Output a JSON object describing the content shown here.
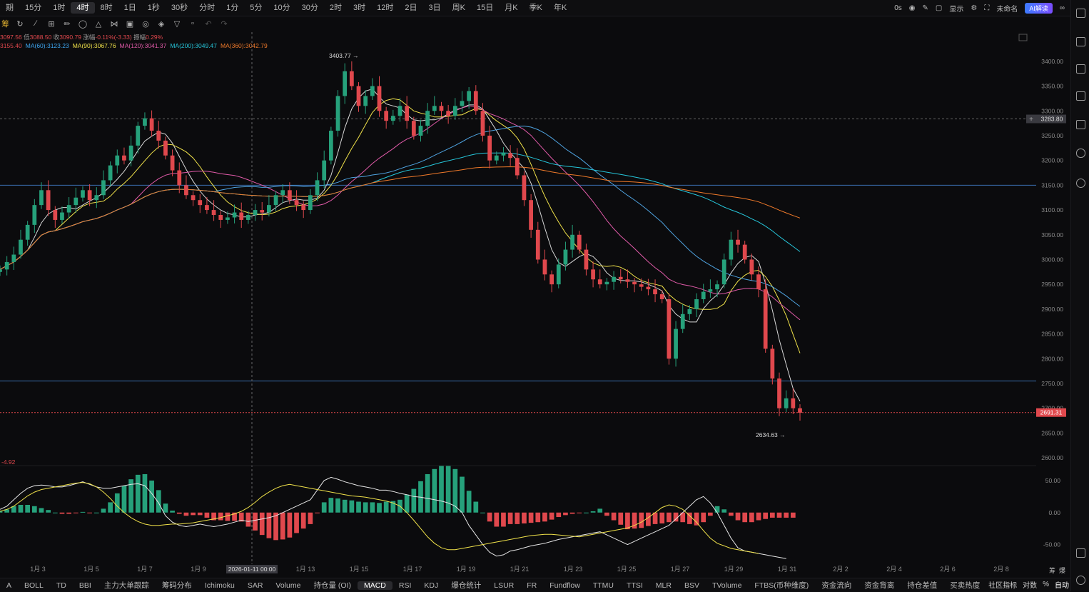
{
  "timeframes": [
    "期",
    "15分",
    "1时",
    "4时",
    "8时",
    "1日",
    "1秒",
    "30秒",
    "分时",
    "1分",
    "5分",
    "10分",
    "30分",
    "2时",
    "3时",
    "12时",
    "2日",
    "3日",
    "周K",
    "15日",
    "月K",
    "季K",
    "年K"
  ],
  "active_timeframe": "4时",
  "topright": {
    "countdown": "0s",
    "display": "显示",
    "layout_name": "未命名",
    "ai_label": "AI解读"
  },
  "toolbar_label": "筹",
  "ohlc": {
    "open": "3097.56",
    "low": "3088.50",
    "close": "3090.79",
    "change": "-0.11%(-3.33)",
    "amp": "0.29%",
    "prefix_open": "",
    "label_low": "低",
    "label_close": "收",
    "label_change": "涨幅",
    "label_amp": "振幅"
  },
  "ma_legend": [
    {
      "text": "3155.40",
      "color": "#e0484d"
    },
    {
      "text": "MA(60):3123.23",
      "color": "#3fa9f5"
    },
    {
      "text": "MA(90):3067.76",
      "color": "#f0e24a"
    },
    {
      "text": "MA(120):3041.37",
      "color": "#e05aa8"
    },
    {
      "text": "MA(200):3049.47",
      "color": "#26c6da"
    },
    {
      "text": "MA(360):3042.79",
      "color": "#f07a2a"
    }
  ],
  "macd_label": "-4.92",
  "indicators": [
    "A",
    "BOLL",
    "TD",
    "BBI",
    "主力大单跟踪",
    "筹码分布",
    "Ichimoku",
    "SAR",
    "Volume",
    "持仓量 (OI)",
    "MACD",
    "RSI",
    "KDJ",
    "爆仓统计",
    "LSUR",
    "FR",
    "Fundflow",
    "TTMU",
    "TTSI",
    "MLR",
    "BSV",
    "TVolume",
    "FTBS(币种维度)",
    "资金流向",
    "资金背离",
    "持仓差值",
    "买卖热度"
  ],
  "active_indicator": "MACD",
  "bottomright": {
    "community": "社区指标",
    "log": "对数",
    "pct": "%",
    "auto": "自动"
  },
  "chip_labels": [
    "筹",
    "爆"
  ],
  "colors": {
    "up": "#26a17b",
    "down": "#e0484d",
    "ma_fast": "#f0e24a",
    "ma_slow": "#d8d8d8",
    "ma_pink": "#e05aa8",
    "ma_blue": "#4fa3e0",
    "ma_cyan": "#26c6da",
    "ma_orange": "#f07a2a",
    "hline": "#3a6fb0"
  },
  "chart_data": {
    "type": "candlestick",
    "price_axis": {
      "ylim": [
        2590,
        3420
      ],
      "ticks": [
        "3400.00",
        "3350.00",
        "3300.00",
        "3250.00",
        "3200.00",
        "3150.00",
        "3100.00",
        "3050.00",
        "3000.00",
        "2950.00",
        "2900.00",
        "2850.00",
        "2800.00",
        "2750.00",
        "2700.00",
        "2650.00",
        "2600.00"
      ]
    },
    "macd_axis": {
      "ylim": [
        -75,
        70
      ],
      "ticks": [
        "50.00",
        "0.00",
        "-50.00"
      ]
    },
    "x_ticks": [
      "1月 3",
      "1月 5",
      "1月 7",
      "1月 9",
      "1月 13",
      "1月 15",
      "1月 17",
      "1月 19",
      "1月 21",
      "1月 23",
      "1月 25",
      "1月 27",
      "1月 29",
      "1月 31",
      "2月 2",
      "2月 4",
      "2月 6",
      "2月 8"
    ],
    "x_tick_days": [
      3,
      5,
      7,
      9,
      13,
      15,
      17,
      19,
      21,
      23,
      25,
      27,
      29,
      31,
      33,
      35,
      37,
      39
    ],
    "crosshair_label": "2026-01-11 00:00",
    "crosshair_day": 11,
    "crosshair_price": "3283.80",
    "last_price": "2691.31",
    "high_label": "3403.77",
    "low_label": "2634.63",
    "horizontal_lines": [
      3150,
      2755
    ],
    "closes": [
      2980,
      2995,
      3010,
      3040,
      3070,
      3110,
      3140,
      3100,
      3080,
      3095,
      3110,
      3125,
      3140,
      3120,
      3130,
      3160,
      3190,
      3210,
      3200,
      3230,
      3270,
      3285,
      3260,
      3240,
      3210,
      3180,
      3150,
      3130,
      3120,
      3110,
      3100,
      3090,
      3080,
      3085,
      3095,
      3080,
      3090,
      3100,
      3095,
      3110,
      3130,
      3140,
      3120,
      3110,
      3100,
      3130,
      3160,
      3200,
      3260,
      3330,
      3380,
      3350,
      3310,
      3330,
      3350,
      3300,
      3280,
      3290,
      3310,
      3280,
      3250,
      3270,
      3300,
      3310,
      3300,
      3290,
      3310,
      3320,
      3340,
      3300,
      3250,
      3200,
      3210,
      3215,
      3205,
      3170,
      3120,
      3060,
      3000,
      2970,
      2950,
      2990,
      3020,
      3050,
      3020,
      2980,
      2960,
      2950,
      2955,
      2965,
      2960,
      2955,
      2950,
      2945,
      2940,
      2930,
      2920,
      2800,
      2860,
      2890,
      2900,
      2920,
      2935,
      2940,
      2950,
      3000,
      3040,
      3030,
      3000,
      2970,
      2940,
      2820,
      2760,
      2700,
      2720,
      2700,
      2691
    ],
    "macd_dif": [
      5,
      10,
      20,
      30,
      38,
      42,
      43,
      42,
      40,
      40,
      42,
      45,
      48,
      44,
      40,
      38,
      38,
      40,
      42,
      44,
      45,
      42,
      30,
      15,
      -5,
      -15,
      -20,
      -22,
      -20,
      -18,
      -20,
      -22,
      -20,
      -18,
      -15,
      -12,
      -14,
      -12,
      -10,
      -8,
      -5,
      0,
      5,
      10,
      15,
      20,
      35,
      50,
      55,
      52,
      48,
      45,
      42,
      40,
      38,
      35,
      35,
      33,
      30,
      28,
      25,
      24,
      22,
      20,
      18,
      15,
      10,
      0,
      -20,
      -35,
      -50,
      -62,
      -68,
      -66,
      -60,
      -58,
      -55,
      -52,
      -50,
      -48,
      -45,
      -42,
      -40,
      -38,
      -36,
      -34,
      -32,
      -30,
      -35,
      -40,
      -45,
      -50,
      -45,
      -40,
      -35,
      -30,
      -25,
      -20,
      -10,
      0,
      10,
      20,
      25,
      15,
      0,
      -20,
      -40,
      -55,
      -60,
      -62,
      -64,
      -66,
      -68,
      -70,
      -72
    ],
    "macd_dea": [
      2,
      5,
      10,
      18,
      26,
      32,
      36,
      38,
      40,
      42,
      44,
      46,
      47,
      45,
      40,
      32,
      22,
      10,
      0,
      -8,
      -14,
      -18,
      -20,
      -20,
      -19,
      -18,
      -18,
      -17,
      -16,
      -14,
      -12,
      -10,
      -8,
      -5,
      -2,
      2,
      8,
      16,
      25,
      32,
      38,
      42,
      44,
      42,
      40,
      38,
      36,
      34,
      32,
      30,
      28,
      26,
      25,
      24,
      22,
      20,
      18,
      15,
      10,
      0,
      -12,
      -25,
      -38,
      -48,
      -55,
      -58,
      -58,
      -56,
      -54,
      -52,
      -50,
      -48,
      -46,
      -44,
      -42,
      -40,
      -38,
      -36,
      -35,
      -34,
      -34,
      -35,
      -36,
      -37,
      -38,
      -36,
      -34,
      -32,
      -30,
      -28,
      -26,
      -24,
      -20,
      -15,
      -8,
      0,
      8,
      12,
      10,
      5,
      -5,
      -15,
      -28,
      -40,
      -48,
      -52,
      -56,
      -58,
      -60,
      -62,
      -64
    ],
    "macd_hist": [
      3,
      5,
      10,
      12,
      12,
      10,
      7,
      4,
      0,
      -2,
      -2,
      -1,
      1,
      -1,
      0,
      6,
      16,
      30,
      42,
      52,
      59,
      60,
      50,
      35,
      14,
      3,
      -2,
      -5,
      -4,
      -4,
      -8,
      -12,
      -12,
      -13,
      -13,
      -14,
      -22,
      -28,
      -35,
      -40,
      -43,
      -42,
      -39,
      -32,
      -25,
      -18,
      -1,
      16,
      23,
      22,
      20,
      19,
      17,
      16,
      16,
      15,
      17,
      18,
      20,
      28,
      37,
      49,
      60,
      68,
      73,
      73,
      68,
      56,
      34,
      17,
      0,
      -14,
      -22,
      -22,
      -18,
      -18,
      -17,
      -16,
      -15,
      -14,
      -11,
      -7,
      -4,
      -2,
      -1,
      0,
      2,
      6,
      -5,
      -12,
      -19,
      -26,
      -25,
      -24,
      -21,
      -18,
      -17,
      -15,
      -14,
      -15,
      -18,
      -20,
      -15,
      -5,
      10,
      5,
      -5,
      -12,
      -15,
      -15,
      -12,
      -10,
      -8,
      -8,
      -8,
      -8
    ]
  }
}
